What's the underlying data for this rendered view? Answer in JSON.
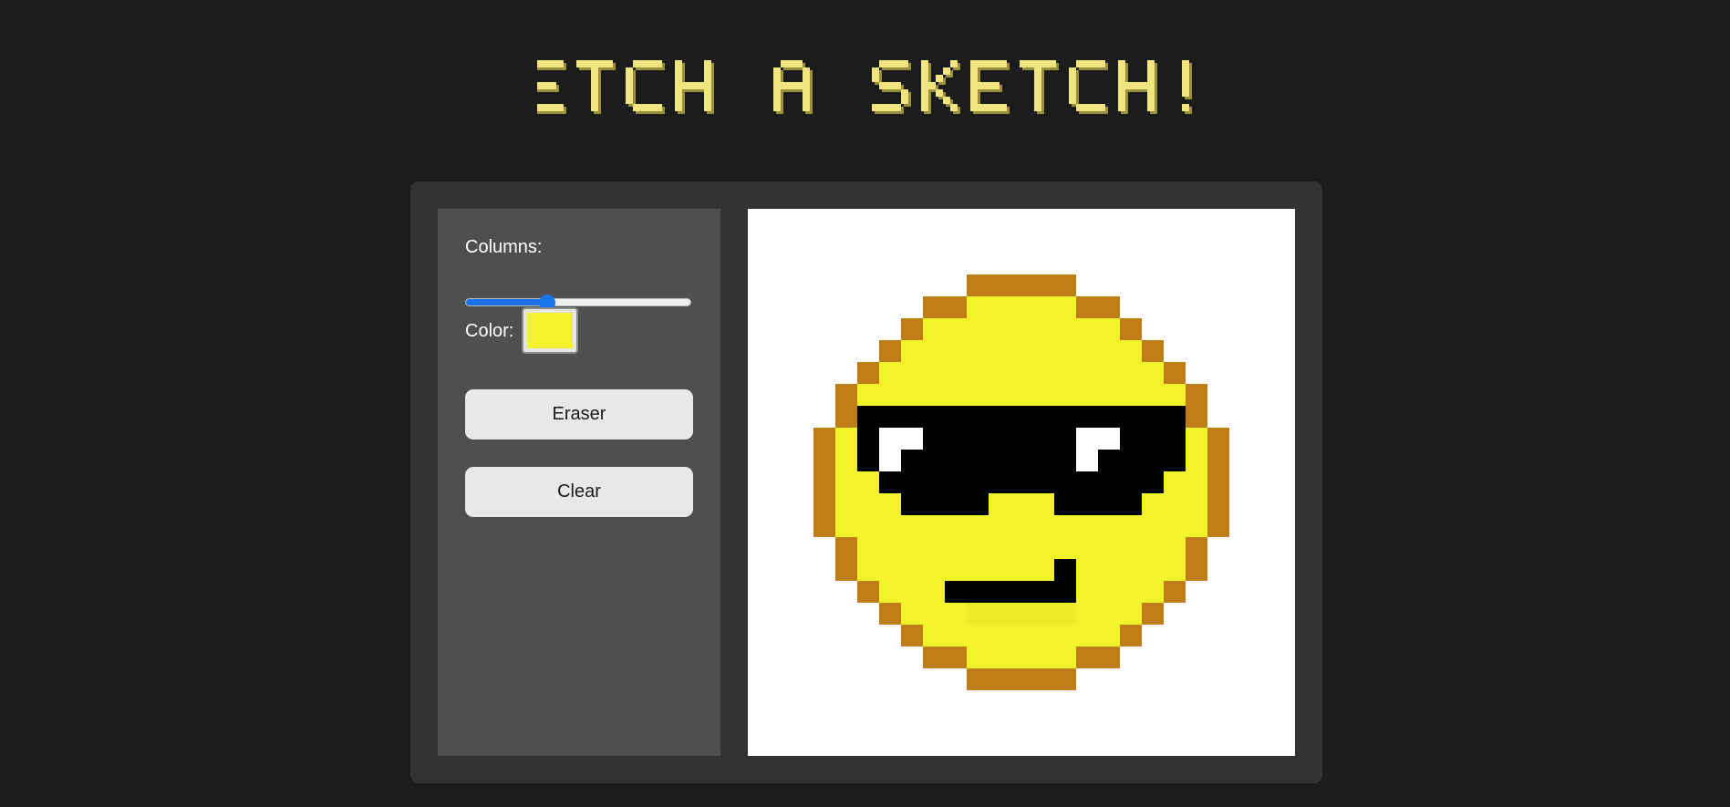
{
  "title": "ETCH A SKETCH!",
  "theme": {
    "background": "#1c1c1c",
    "title_color": "#f0e680",
    "title_shadow": "#9a8f3c",
    "panel": "#333333",
    "sidebar": "#4f4f4f",
    "slider_accent": "#1a73e8"
  },
  "controls": {
    "columns_label": "Columns:",
    "columns_slider_fraction": 0.36,
    "color_label": "Color:",
    "selected_color": "#f2f22d",
    "eraser_label": "Eraser",
    "clear_label": "Clear"
  },
  "drawing": {
    "palette": {
      "Y": "#f2f22d",
      "O": "#bf7e17",
      "K": "#000000",
      "W": "#ffffff",
      "L": "#ecec2a"
    },
    "rows": [
      ".........................",
      ".........................",
      ".........................",
      "..........OOOOO..........",
      "........OOYYYYYOO........",
      ".......OYYYYYYYYYO.......",
      "......OYYYYYYYYYYYO......",
      ".....OYYYYYYYYYYYYYO.....",
      "....OYYYYYYYYYYYYYYYO....",
      "....OKKKKKKKKKKKKKKKO....",
      "...OYKWWKKKKKKKWWKKKYO...",
      "...OYKWKKKKKKKKWKKKKYO...",
      "...OYYKKKKKKKKKKKKKYYO...",
      "...OYYYKKKKYYYKKKKYYYO...",
      "...OYYYYYYYYYYYYYYYYYO...",
      "....OYYYYYYYYYYYYYYYO....",
      "....OYYYYYYYYYKYYYYYO....",
      ".....OYYYKKKKKKYYYYO.....",
      "......OYYYLLLLLYYYO......",
      ".......OYYYYYYYYYO.......",
      "........OOYYYYYOO........",
      "..........OOOOO..........",
      ".........................",
      ".........................",
      "........................."
    ]
  }
}
